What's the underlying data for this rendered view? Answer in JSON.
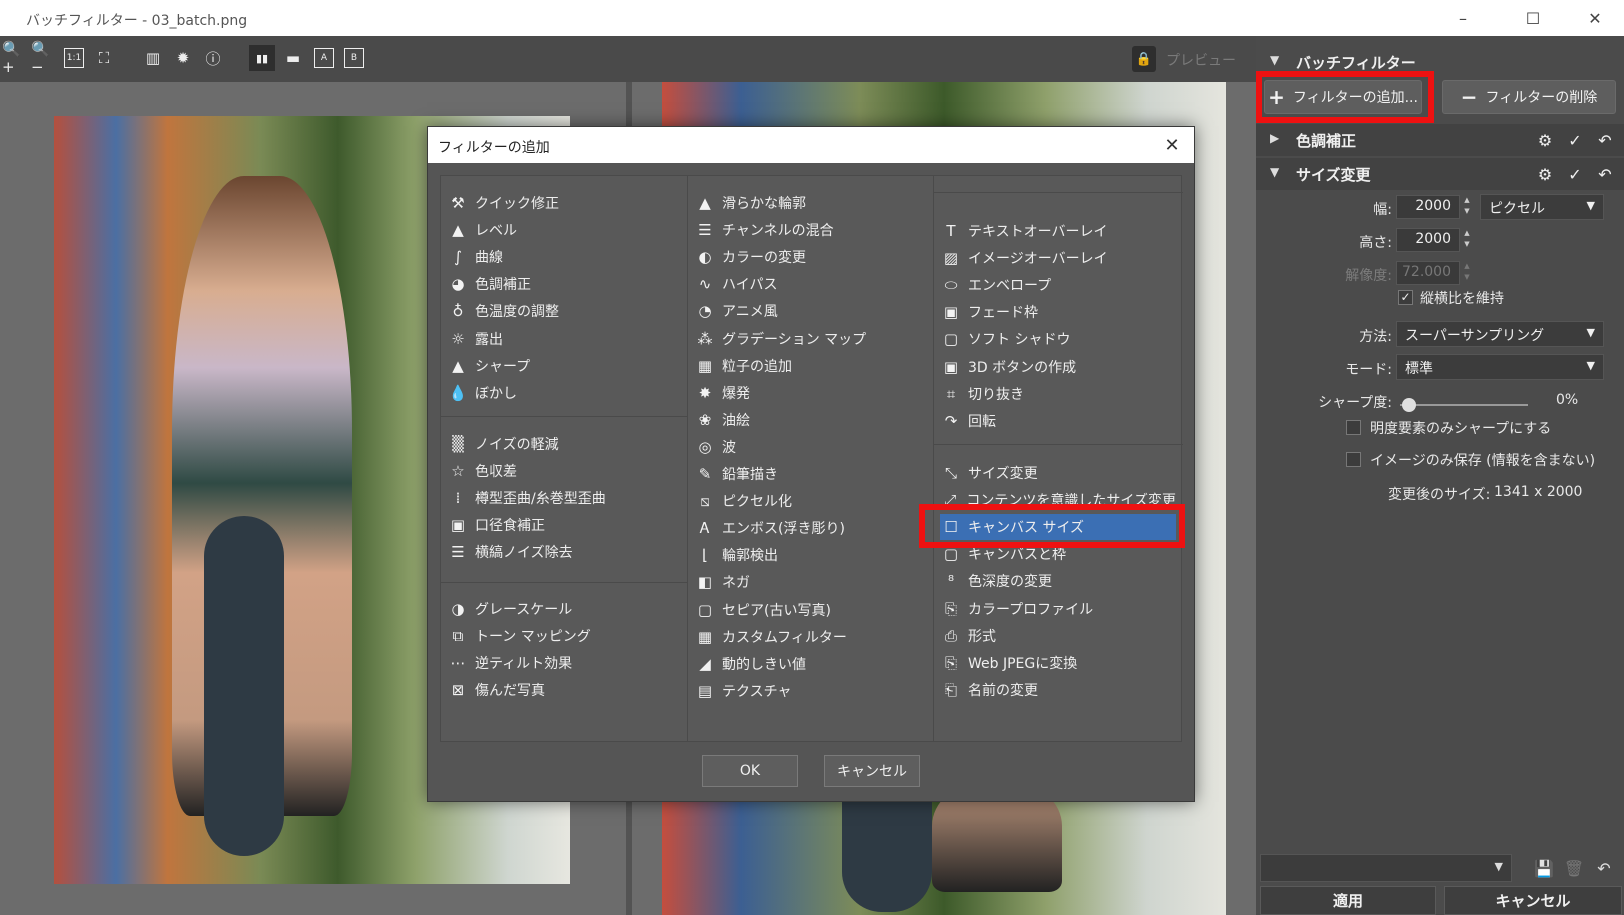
{
  "window": {
    "title": "バッチフィルター - 03_batch.png",
    "controls": [
      "–",
      "☐",
      "✕"
    ]
  },
  "toolbar": {
    "items": [
      {
        "name": "zoom-in-icon",
        "glyph": "🔍+"
      },
      {
        "name": "zoom-out-icon",
        "glyph": "🔍−"
      },
      {
        "name": "actual-size-icon",
        "glyph": "1:1"
      },
      {
        "name": "fit-screen-icon",
        "glyph": "⛶"
      },
      {
        "name": "histogram-icon",
        "glyph": "▥"
      },
      {
        "name": "settings-sun-icon",
        "glyph": "✹"
      },
      {
        "name": "info-icon",
        "glyph": "ⓘ"
      },
      {
        "name": "split-vertical-icon",
        "glyph": "▮▮"
      },
      {
        "name": "split-horizontal-icon",
        "glyph": "▬"
      },
      {
        "name": "view-a-icon",
        "glyph": "A"
      },
      {
        "name": "view-b-icon",
        "glyph": "B"
      }
    ],
    "lock_icon": "🔒",
    "preview_label": "プレビュー"
  },
  "side": {
    "title": "バッチフィルター",
    "add_filter_label": "フィルターの追加...",
    "remove_filter_label": "フィルターの削除",
    "sections": [
      {
        "label": "色調補正",
        "arrow": "▶",
        "expanded": false
      },
      {
        "label": "サイズ変更",
        "arrow": "▼",
        "expanded": true
      }
    ],
    "resize": {
      "width_label": "幅:",
      "width_value": "2000",
      "unit": "ピクセル",
      "height_label": "高さ:",
      "height_value": "2000",
      "resolution_label": "解像度:",
      "resolution_value": "72.000",
      "keep_ratio_label": "縦横比を維持",
      "keep_ratio_checked": true,
      "method_label": "方法:",
      "method_value": "スーパーサンプリング",
      "mode_label": "モード:",
      "mode_value": "標準",
      "sharpness_label": "シャープ度:",
      "sharpness_value": "0%",
      "sharpness_level": 0,
      "luma_only_label": "明度要素のみシャープにする",
      "image_only_label": "イメージのみ保存 (情報を含まない)",
      "result_label": "変更後のサイズ:",
      "result_value": "1341 x 2000"
    },
    "apply_label": "適用",
    "cancel_label": "キャンセル"
  },
  "dialog": {
    "title": "フィルターの追加",
    "ok_label": "OK",
    "cancel_label": "キャンセル",
    "columns": [
      {
        "groups": [
          [
            {
              "label": "クイック修正",
              "icon": "wand-icon",
              "glyph": "⚒"
            },
            {
              "label": "レベル",
              "icon": "levels-icon",
              "glyph": "▲"
            },
            {
              "label": "曲線",
              "icon": "curves-icon",
              "glyph": "∫"
            },
            {
              "label": "色調補正",
              "icon": "palette-icon",
              "glyph": "◕"
            },
            {
              "label": "色温度の調整",
              "icon": "bulb-icon",
              "glyph": "♁"
            },
            {
              "label": "露出",
              "icon": "sun-icon",
              "glyph": "☼"
            },
            {
              "label": "シャープ",
              "icon": "sharpen-icon",
              "glyph": "▲"
            },
            {
              "label": "ぼかし",
              "icon": "drop-icon",
              "glyph": "💧"
            }
          ],
          [
            {
              "label": "ノイズの軽減",
              "icon": "noise-icon",
              "glyph": "▒"
            },
            {
              "label": "色収差",
              "icon": "star-icon",
              "glyph": "☆"
            },
            {
              "label": "樽型歪曲/糸巻型歪曲",
              "icon": "grid-icon",
              "glyph": "⁞"
            },
            {
              "label": "口径食補正",
              "icon": "vignette-icon",
              "glyph": "▣"
            },
            {
              "label": "横縞ノイズ除去",
              "icon": "stripes-icon",
              "glyph": "☰"
            }
          ],
          [
            {
              "label": "グレースケール",
              "icon": "grayscale-icon",
              "glyph": "◑"
            },
            {
              "label": "トーン マッピング",
              "icon": "tone-icon",
              "glyph": "⧉"
            },
            {
              "label": "逆ティルト効果",
              "icon": "tilt-icon",
              "glyph": "⋯"
            },
            {
              "label": "傷んだ写真",
              "icon": "damaged-icon",
              "glyph": "⊠"
            }
          ]
        ]
      },
      {
        "groups": [
          [
            {
              "label": "滑らかな輪郭",
              "icon": "smooth-icon",
              "glyph": "▲"
            },
            {
              "label": "チャンネルの混合",
              "icon": "channel-icon",
              "glyph": "☰"
            },
            {
              "label": "カラーの変更",
              "icon": "color-change-icon",
              "glyph": "◐"
            },
            {
              "label": "ハイパス",
              "icon": "highpass-icon",
              "glyph": "∿"
            },
            {
              "label": "アニメ風",
              "icon": "anime-icon",
              "glyph": "◔"
            },
            {
              "label": "グラデーション マップ",
              "icon": "gradient-icon",
              "glyph": "⁂"
            },
            {
              "label": "粒子の追加",
              "icon": "grain-icon",
              "glyph": "▦"
            },
            {
              "label": "爆発",
              "icon": "explode-icon",
              "glyph": "✸"
            },
            {
              "label": "油絵",
              "icon": "oil-icon",
              "glyph": "❀"
            },
            {
              "label": "波",
              "icon": "wave-icon",
              "glyph": "◎"
            },
            {
              "label": "鉛筆描き",
              "icon": "pencil-icon",
              "glyph": "✎"
            },
            {
              "label": "ピクセル化",
              "icon": "pixelate-icon",
              "glyph": "⧅"
            },
            {
              "label": "エンボス(浮き彫り)",
              "icon": "emboss-icon",
              "glyph": "Ꭺ"
            },
            {
              "label": "輪郭検出",
              "icon": "edge-icon",
              "glyph": "⌊"
            },
            {
              "label": "ネガ",
              "icon": "negative-icon",
              "glyph": "◧"
            },
            {
              "label": "セピア(古い写真)",
              "icon": "sepia-icon",
              "glyph": "▢"
            },
            {
              "label": "カスタムフィルター",
              "icon": "custom-icon",
              "glyph": "▦"
            },
            {
              "label": "動的しきい値",
              "icon": "threshold-icon",
              "glyph": "◢"
            },
            {
              "label": "テクスチャ",
              "icon": "texture-icon",
              "glyph": "▤"
            }
          ]
        ]
      },
      {
        "groups": [
          [
            {
              "label": "テキストオーバーレイ",
              "icon": "text-icon",
              "glyph": "T"
            },
            {
              "label": "イメージオーバーレイ",
              "icon": "image-overlay-icon",
              "glyph": "▨"
            },
            {
              "label": "エンベロープ",
              "icon": "envelope-icon",
              "glyph": "⬭"
            },
            {
              "label": "フェード枠",
              "icon": "fade-frame-icon",
              "glyph": "▣"
            },
            {
              "label": "ソフト シャドウ",
              "icon": "shadow-icon",
              "glyph": "▢"
            },
            {
              "label": "3D ボタンの作成",
              "icon": "button3d-icon",
              "glyph": "▣"
            },
            {
              "label": "切り抜き",
              "icon": "crop-icon",
              "glyph": "⌗"
            },
            {
              "label": "回転",
              "icon": "rotate-icon",
              "glyph": "↷"
            }
          ],
          [
            {
              "label": "サイズ変更",
              "icon": "resize-icon",
              "glyph": "⤡"
            },
            {
              "label": "コンテンツを意識したサイズ変更",
              "icon": "content-resize-icon",
              "glyph": "⤢"
            },
            {
              "label": "キャンバス サイズ",
              "icon": "canvas-size-icon",
              "glyph": "☐",
              "selected": true
            },
            {
              "label": "キャンバスと枠",
              "icon": "canvas-frame-icon",
              "glyph": "▢"
            },
            {
              "label": "色深度の変更",
              "icon": "depth-icon",
              "glyph": "⁸"
            },
            {
              "label": "カラープロファイル",
              "icon": "profile-icon",
              "glyph": "⎘"
            },
            {
              "label": "形式",
              "icon": "format-icon",
              "glyph": "⎙"
            },
            {
              "label": "Web JPEGに変換",
              "icon": "web-jpeg-icon",
              "glyph": "⎘"
            },
            {
              "label": "名前の変更",
              "icon": "rename-icon",
              "glyph": "⎗"
            }
          ]
        ]
      }
    ]
  },
  "colors": {
    "highlight": "#ee1111",
    "selection": "#3b6fb4"
  }
}
